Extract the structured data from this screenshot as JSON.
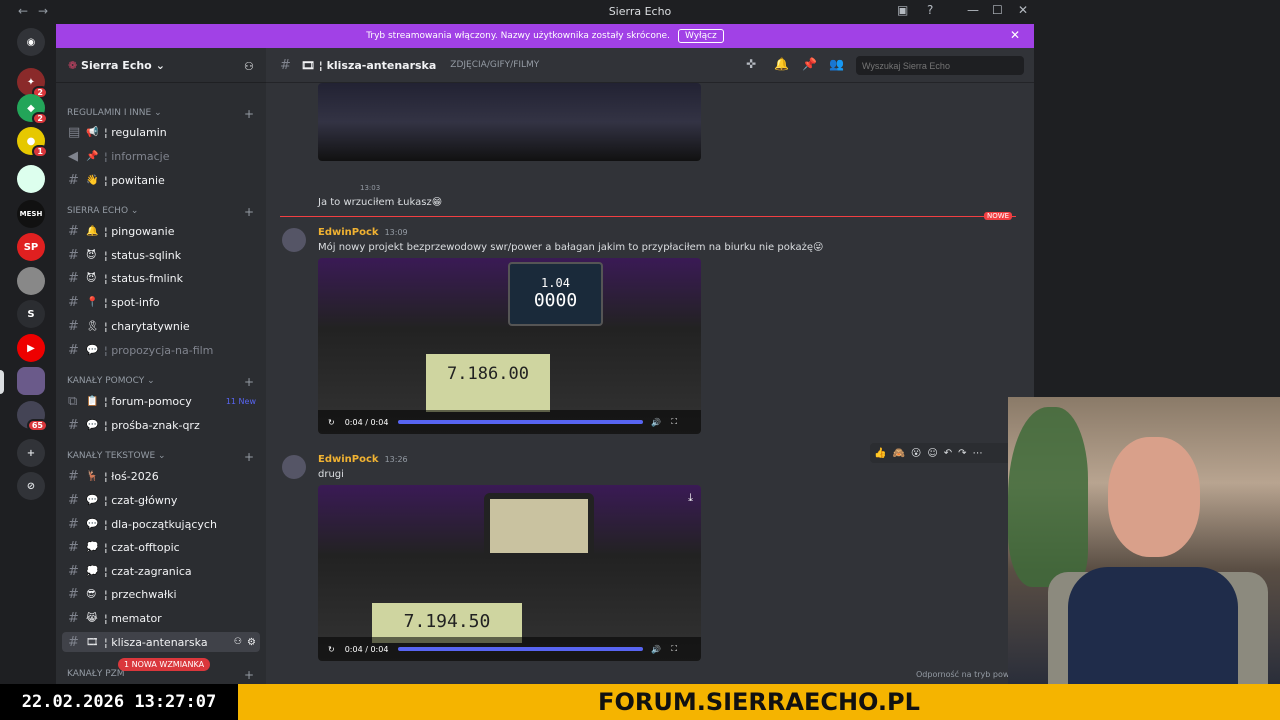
{
  "window": {
    "title": "Sierra Echo"
  },
  "banner": {
    "text": "Tryb streamowania włączony. Nazwy użytkownika zostały skrócone.",
    "button": "Wyłącz"
  },
  "guild": {
    "name": "Sierra Echo"
  },
  "categories": {
    "reg": "REGULAMIN I INNE",
    "sierra": "SIERRA ECHO",
    "pomoc": "KANAŁY POMOCY",
    "tekstowe": "KANAŁY TEKSTOWE",
    "pzm": "KANAŁY PZM"
  },
  "channels": [
    {
      "label": "regulamin",
      "emoji": "📢"
    },
    {
      "label": "informacje",
      "emoji": "📌"
    },
    {
      "label": "powitanie",
      "emoji": "👋"
    },
    {
      "label": "pingowanie",
      "emoji": "🔔"
    },
    {
      "label": "status-sqlink",
      "emoji": "😈"
    },
    {
      "label": "status-fmlink",
      "emoji": "😈"
    },
    {
      "label": "spot-info",
      "emoji": "📍"
    },
    {
      "label": "charytatywnie",
      "emoji": "🎗"
    },
    {
      "label": "propozycja-na-film",
      "emoji": "💬"
    },
    {
      "label": "forum-pomocy",
      "emoji": "📋",
      "badge": "11 New"
    },
    {
      "label": "prośba-znak-qrz",
      "emoji": "💬"
    },
    {
      "label": "łoś-2026",
      "emoji": "🦌"
    },
    {
      "label": "czat-główny",
      "emoji": "💬"
    },
    {
      "label": "dla-początkujących",
      "emoji": "💬"
    },
    {
      "label": "czat-offtopic",
      "emoji": "💭"
    },
    {
      "label": "czat-zagranica",
      "emoji": "💭"
    },
    {
      "label": "przechwałki",
      "emoji": "😎"
    },
    {
      "label": "memator",
      "emoji": "😹"
    },
    {
      "label": "klisza-antenarska",
      "emoji": "🎞"
    }
  ],
  "mention_pill": "1 NOWA WZMIANKA",
  "topbar": {
    "channel": "klisza-antenarska",
    "topic": "ZDJĘCIA/GIFY/FILMY",
    "search_placeholder": "Wyszukaj Sierra Echo"
  },
  "messages": [
    {
      "time": "13:03",
      "text": "Ja to wrzuciłem Łukasz😁"
    },
    {
      "author": "EdwinPock",
      "time": "13:09",
      "text": "Mój nowy projekt bezprzewodowy swr/power a bałagan jakim to przypłaciłem na biurku nie pokażę😜",
      "video_time": "0:04 / 0:04",
      "display_freq": "7.186.00",
      "meter": "1.04",
      "meter2": "0000"
    },
    {
      "author": "EdwinPock",
      "time": "13:26",
      "text": "drugi",
      "video_time": "0:04 / 0:04",
      "display_freq": "7.194.50"
    }
  ],
  "new_label": "NOWE",
  "status_note": "Odporność na tryb pow...",
  "ticker": {
    "datetime": "22.02.2026 13:27:07",
    "url": "FORUM.SIERRAECHO.PL"
  },
  "colors": {
    "accent": "#5865f2",
    "banner": "#a141e6",
    "ticker": "#f5b400",
    "author": "#f0b232"
  }
}
